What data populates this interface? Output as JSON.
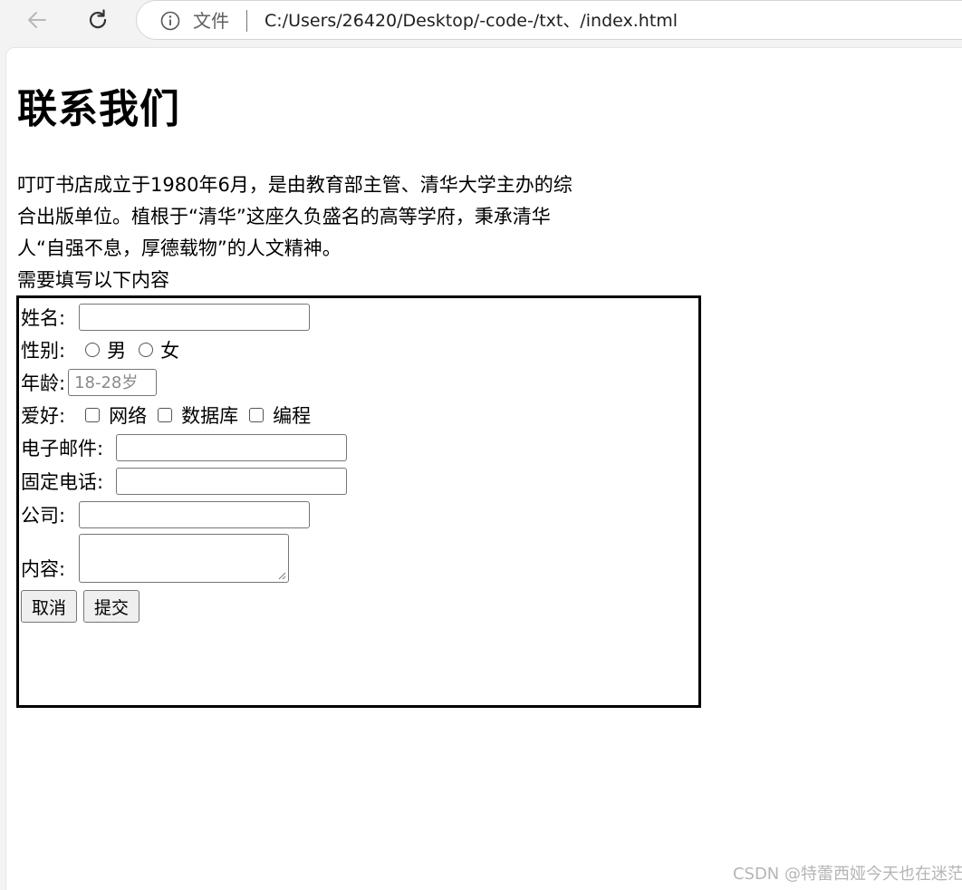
{
  "browser": {
    "file_label": "文件",
    "url": "C:/Users/26420/Desktop/-code-/txt、/index.html"
  },
  "page": {
    "title": "联系我们",
    "intro": "叮叮书店成立于1980年6月，是由教育部主管、清华大学主办的综合出版单位。植根于“清华”这座久负盛名的高等学府，秉承清华人“自强不息，厚德载物”的人文精神。",
    "form_caption": "需要填写以下内容"
  },
  "form": {
    "name_label": "姓名:",
    "gender_label": "性别:",
    "gender_options": [
      "男",
      "女"
    ],
    "age_label": "年龄:",
    "age_placeholder": "18-28岁",
    "hobby_label": "爱好:",
    "hobby_options": [
      "网络",
      "数据库",
      "编程"
    ],
    "email_label": "电子邮件:",
    "phone_label": "固定电话:",
    "company_label": "公司:",
    "content_label": "内容:",
    "cancel_button": "取消",
    "submit_button": "提交"
  },
  "watermark": "CSDN @特蕾西娅今天也在迷茫"
}
